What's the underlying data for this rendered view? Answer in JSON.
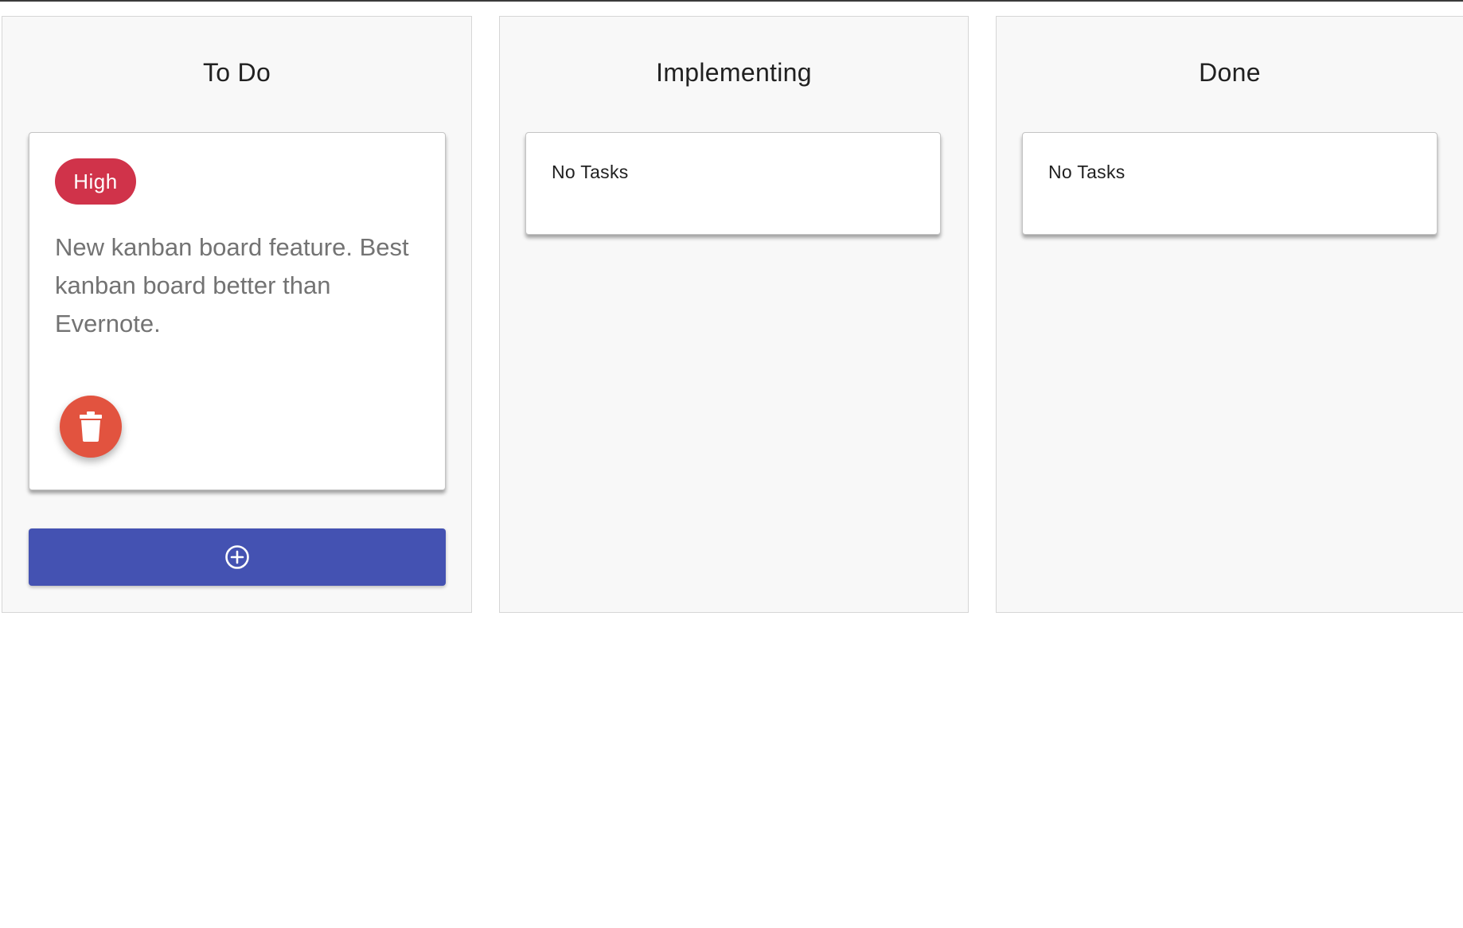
{
  "board": {
    "columns": [
      {
        "title": "To Do",
        "tasks": [
          {
            "priority": "High",
            "description": "New kanban board feature. Best kanban board better than Evernote."
          }
        ]
      },
      {
        "title": "Implementing",
        "empty_label": "No Tasks"
      },
      {
        "title": "Done",
        "empty_label": "No Tasks"
      }
    ]
  },
  "icons": {
    "delete": "trash-icon",
    "add": "plus-circle-icon"
  },
  "colors": {
    "priority_high": "#d0334a",
    "delete_button": "#e2533f",
    "add_button": "#4452b2",
    "column_background": "#f8f8f8",
    "task_text": "#737373"
  }
}
